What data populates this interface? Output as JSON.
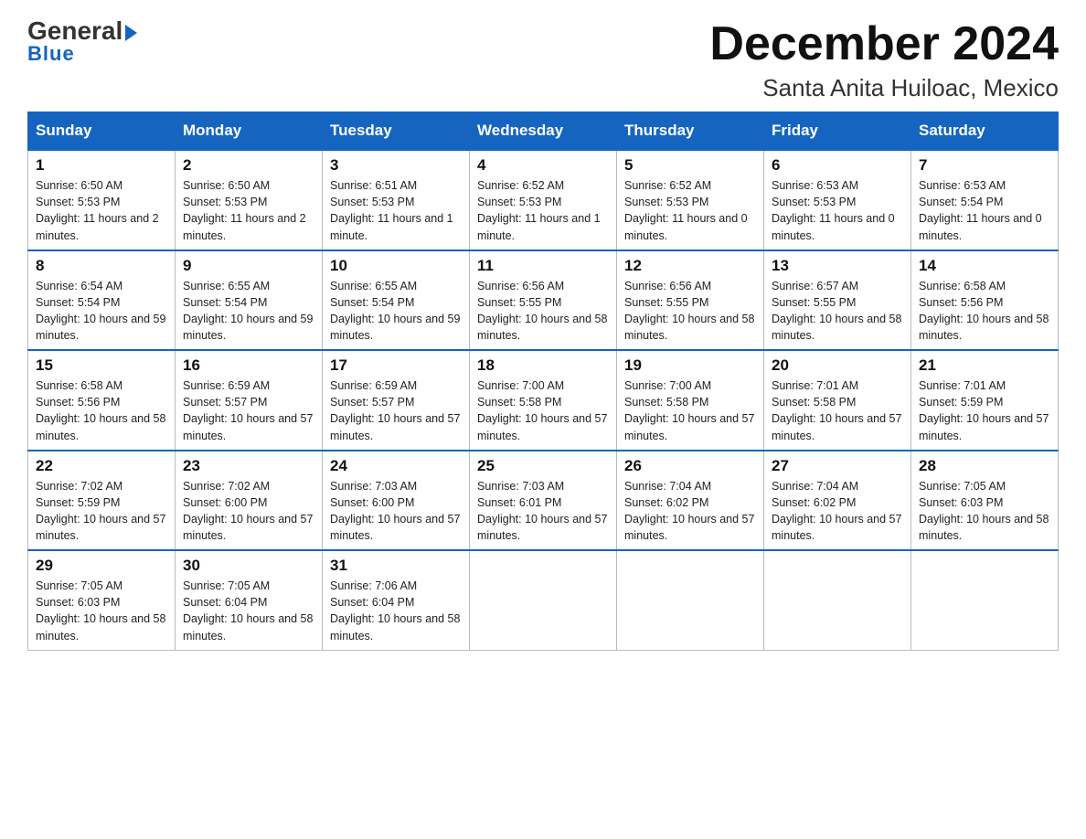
{
  "logo": {
    "line1": "General",
    "arrow": "▶",
    "line2": "Blue"
  },
  "title": "December 2024",
  "location": "Santa Anita Huiloac, Mexico",
  "days_of_week": [
    "Sunday",
    "Monday",
    "Tuesday",
    "Wednesday",
    "Thursday",
    "Friday",
    "Saturday"
  ],
  "weeks": [
    [
      {
        "day": "1",
        "sunrise": "6:50 AM",
        "sunset": "5:53 PM",
        "daylight": "11 hours and 2 minutes."
      },
      {
        "day": "2",
        "sunrise": "6:50 AM",
        "sunset": "5:53 PM",
        "daylight": "11 hours and 2 minutes."
      },
      {
        "day": "3",
        "sunrise": "6:51 AM",
        "sunset": "5:53 PM",
        "daylight": "11 hours and 1 minute."
      },
      {
        "day": "4",
        "sunrise": "6:52 AM",
        "sunset": "5:53 PM",
        "daylight": "11 hours and 1 minute."
      },
      {
        "day": "5",
        "sunrise": "6:52 AM",
        "sunset": "5:53 PM",
        "daylight": "11 hours and 0 minutes."
      },
      {
        "day": "6",
        "sunrise": "6:53 AM",
        "sunset": "5:53 PM",
        "daylight": "11 hours and 0 minutes."
      },
      {
        "day": "7",
        "sunrise": "6:53 AM",
        "sunset": "5:54 PM",
        "daylight": "11 hours and 0 minutes."
      }
    ],
    [
      {
        "day": "8",
        "sunrise": "6:54 AM",
        "sunset": "5:54 PM",
        "daylight": "10 hours and 59 minutes."
      },
      {
        "day": "9",
        "sunrise": "6:55 AM",
        "sunset": "5:54 PM",
        "daylight": "10 hours and 59 minutes."
      },
      {
        "day": "10",
        "sunrise": "6:55 AM",
        "sunset": "5:54 PM",
        "daylight": "10 hours and 59 minutes."
      },
      {
        "day": "11",
        "sunrise": "6:56 AM",
        "sunset": "5:55 PM",
        "daylight": "10 hours and 58 minutes."
      },
      {
        "day": "12",
        "sunrise": "6:56 AM",
        "sunset": "5:55 PM",
        "daylight": "10 hours and 58 minutes."
      },
      {
        "day": "13",
        "sunrise": "6:57 AM",
        "sunset": "5:55 PM",
        "daylight": "10 hours and 58 minutes."
      },
      {
        "day": "14",
        "sunrise": "6:58 AM",
        "sunset": "5:56 PM",
        "daylight": "10 hours and 58 minutes."
      }
    ],
    [
      {
        "day": "15",
        "sunrise": "6:58 AM",
        "sunset": "5:56 PM",
        "daylight": "10 hours and 58 minutes."
      },
      {
        "day": "16",
        "sunrise": "6:59 AM",
        "sunset": "5:57 PM",
        "daylight": "10 hours and 57 minutes."
      },
      {
        "day": "17",
        "sunrise": "6:59 AM",
        "sunset": "5:57 PM",
        "daylight": "10 hours and 57 minutes."
      },
      {
        "day": "18",
        "sunrise": "7:00 AM",
        "sunset": "5:58 PM",
        "daylight": "10 hours and 57 minutes."
      },
      {
        "day": "19",
        "sunrise": "7:00 AM",
        "sunset": "5:58 PM",
        "daylight": "10 hours and 57 minutes."
      },
      {
        "day": "20",
        "sunrise": "7:01 AM",
        "sunset": "5:58 PM",
        "daylight": "10 hours and 57 minutes."
      },
      {
        "day": "21",
        "sunrise": "7:01 AM",
        "sunset": "5:59 PM",
        "daylight": "10 hours and 57 minutes."
      }
    ],
    [
      {
        "day": "22",
        "sunrise": "7:02 AM",
        "sunset": "5:59 PM",
        "daylight": "10 hours and 57 minutes."
      },
      {
        "day": "23",
        "sunrise": "7:02 AM",
        "sunset": "6:00 PM",
        "daylight": "10 hours and 57 minutes."
      },
      {
        "day": "24",
        "sunrise": "7:03 AM",
        "sunset": "6:00 PM",
        "daylight": "10 hours and 57 minutes."
      },
      {
        "day": "25",
        "sunrise": "7:03 AM",
        "sunset": "6:01 PM",
        "daylight": "10 hours and 57 minutes."
      },
      {
        "day": "26",
        "sunrise": "7:04 AM",
        "sunset": "6:02 PM",
        "daylight": "10 hours and 57 minutes."
      },
      {
        "day": "27",
        "sunrise": "7:04 AM",
        "sunset": "6:02 PM",
        "daylight": "10 hours and 57 minutes."
      },
      {
        "day": "28",
        "sunrise": "7:05 AM",
        "sunset": "6:03 PM",
        "daylight": "10 hours and 58 minutes."
      }
    ],
    [
      {
        "day": "29",
        "sunrise": "7:05 AM",
        "sunset": "6:03 PM",
        "daylight": "10 hours and 58 minutes."
      },
      {
        "day": "30",
        "sunrise": "7:05 AM",
        "sunset": "6:04 PM",
        "daylight": "10 hours and 58 minutes."
      },
      {
        "day": "31",
        "sunrise": "7:06 AM",
        "sunset": "6:04 PM",
        "daylight": "10 hours and 58 minutes."
      },
      null,
      null,
      null,
      null
    ]
  ]
}
